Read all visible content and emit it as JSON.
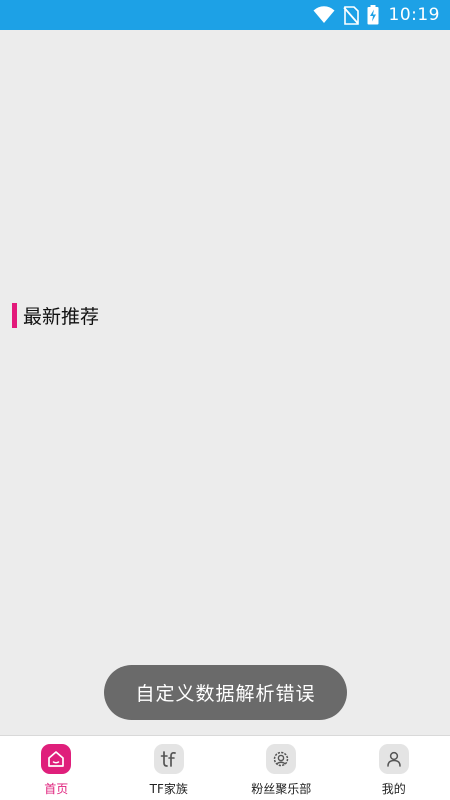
{
  "status_bar": {
    "time": "10:19",
    "icons": [
      "wifi-icon",
      "no-sim-icon",
      "battery-charging-icon"
    ]
  },
  "section": {
    "title": "最新推荐",
    "accent_color": "#e3197a"
  },
  "toast": {
    "message": "自定义数据解析错误"
  },
  "bottom_nav": {
    "active_color": "#df1f7b",
    "items": [
      {
        "label": "首页",
        "icon": "home-icon",
        "active": true
      },
      {
        "label": "TF家族",
        "icon": "tf-logo-icon",
        "active": false
      },
      {
        "label": "粉丝聚乐部",
        "icon": "fan-club-icon",
        "active": false
      },
      {
        "label": "我的",
        "icon": "user-icon",
        "active": false
      }
    ]
  }
}
